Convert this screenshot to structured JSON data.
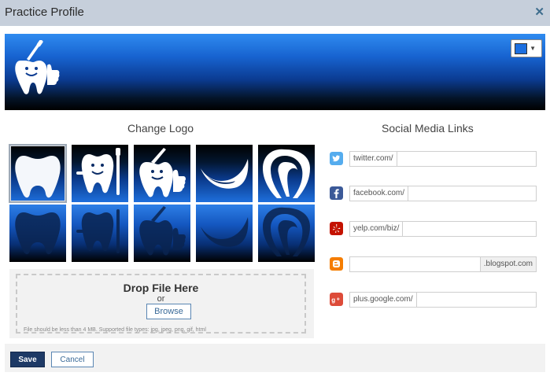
{
  "dialog": {
    "title": "Practice Profile",
    "close_icon": "close-icon"
  },
  "banner": {
    "logo_icon": "tooth-thumbs-up-icon",
    "color_picker": {
      "selected_color": "#1c6fe0",
      "caret_icon": "caret-down-icon"
    }
  },
  "change_logo": {
    "heading": "Change Logo",
    "logos": [
      {
        "icon": "tooth-icon",
        "variant": "light",
        "selected": true
      },
      {
        "icon": "smiling-tooth-toothbrush-icon",
        "variant": "light",
        "selected": false
      },
      {
        "icon": "tooth-thumbs-up-icon",
        "variant": "light",
        "selected": false
      },
      {
        "icon": "smile-curve-icon",
        "variant": "light",
        "selected": false
      },
      {
        "icon": "stylized-tooth-icon",
        "variant": "light",
        "selected": false
      },
      {
        "icon": "tooth-icon",
        "variant": "dark",
        "selected": false
      },
      {
        "icon": "smiling-tooth-toothbrush-icon",
        "variant": "dark",
        "selected": false
      },
      {
        "icon": "tooth-thumbs-up-icon",
        "variant": "dark",
        "selected": false
      },
      {
        "icon": "smile-curve-icon",
        "variant": "dark",
        "selected": false
      },
      {
        "icon": "stylized-tooth-icon",
        "variant": "dark",
        "selected": false
      }
    ],
    "dropzone": {
      "title": "Drop File Here",
      "or": "or",
      "browse_label": "Browse",
      "note": "File should be less than 4 MB. Supported file types: jpg, jpeg, png, gif, html"
    }
  },
  "social_media": {
    "heading": "Social Media Links",
    "links": [
      {
        "icon": "twitter-icon",
        "color": "#55acee",
        "prefix": "twitter.com/",
        "suffix": "",
        "value": ""
      },
      {
        "icon": "facebook-icon",
        "color": "#3b5998",
        "prefix": "facebook.com/",
        "suffix": "",
        "value": ""
      },
      {
        "icon": "yelp-icon",
        "color": "#c41200",
        "prefix": "yelp.com/biz/",
        "suffix": "",
        "value": ""
      },
      {
        "icon": "blogger-icon",
        "color": "#f57d00",
        "prefix": "",
        "suffix": ".blogspot.com",
        "value": ""
      },
      {
        "icon": "google-plus-icon",
        "color": "#dd4b39",
        "prefix": "plus.google.com/",
        "suffix": "",
        "value": ""
      }
    ]
  },
  "footer": {
    "save_label": "Save",
    "cancel_label": "Cancel"
  }
}
